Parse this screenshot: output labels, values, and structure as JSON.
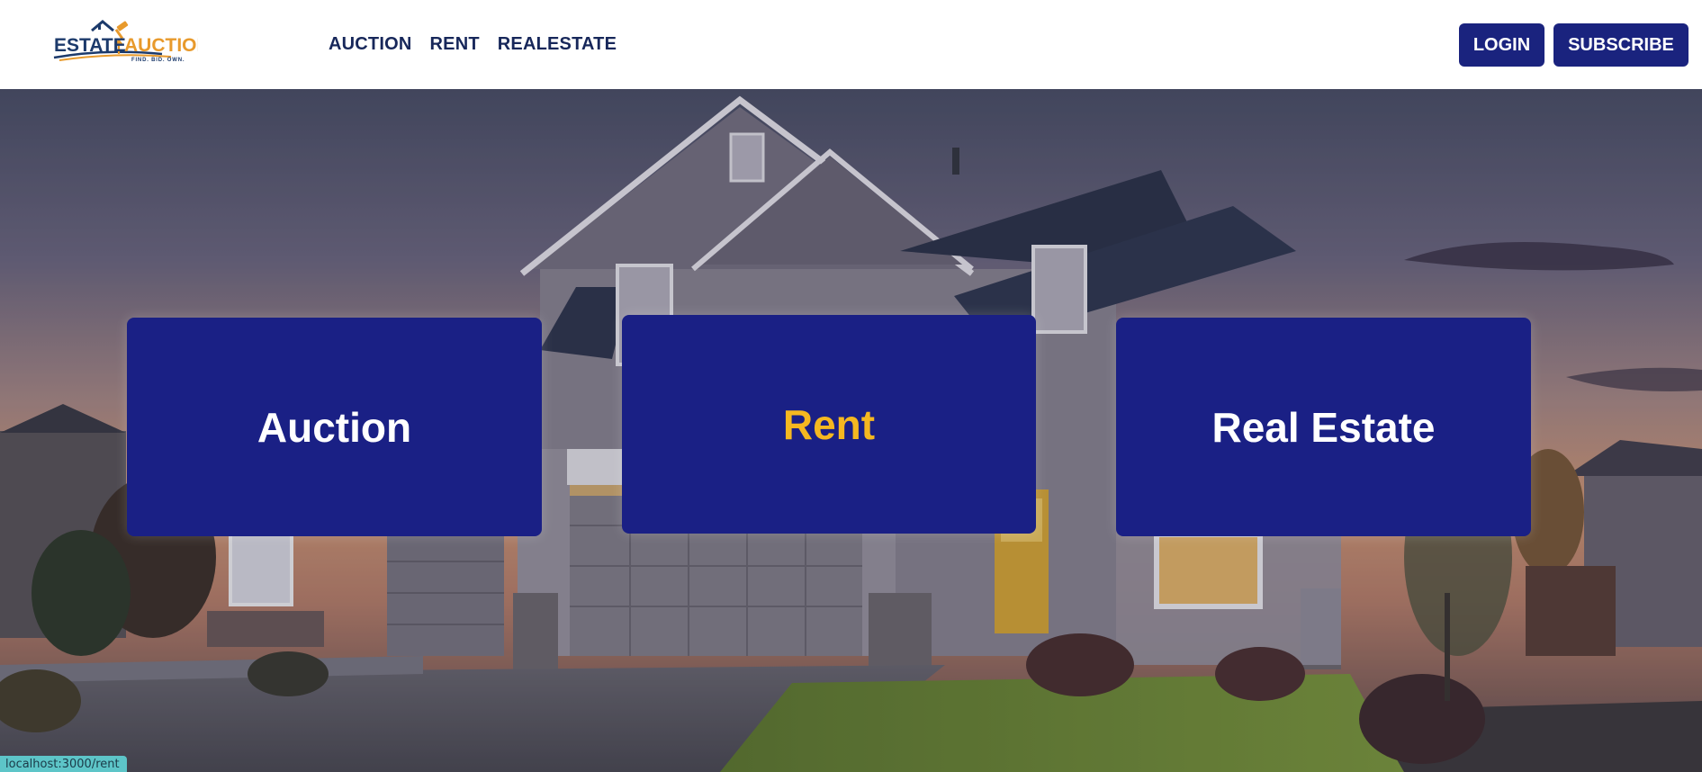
{
  "header": {
    "logo": {
      "word_left": "ESTATE",
      "word_right": "AUCTION",
      "tagline": "FIND. BID. OWN.",
      "icon": "gavel-house-icon"
    },
    "nav": [
      {
        "label": "AUCTION"
      },
      {
        "label": "RENT"
      },
      {
        "label": "REALESTATE"
      }
    ],
    "login_label": "LOGIN",
    "subscribe_label": "SUBSCRIBE"
  },
  "hero": {
    "background": "house-at-dusk-photo",
    "cards": [
      {
        "label": "Auction"
      },
      {
        "label": "Rent"
      },
      {
        "label": "Real Estate"
      }
    ]
  },
  "status": {
    "url": "localhost:3000/rent"
  },
  "colors": {
    "navy": "#1a237e",
    "nav_text": "#17275a",
    "accent": "#f5b820",
    "logo_orange": "#e89a2c"
  }
}
